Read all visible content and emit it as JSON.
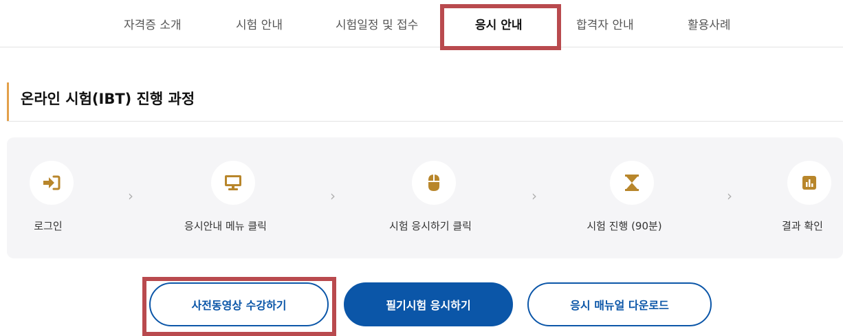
{
  "nav": {
    "items": [
      {
        "label": "자격증 소개"
      },
      {
        "label": "시험 안내"
      },
      {
        "label": "시험일정 및 접수"
      },
      {
        "label": "응시 안내"
      },
      {
        "label": "합격자 안내"
      },
      {
        "label": "활용사례"
      }
    ],
    "active_index": 3
  },
  "section": {
    "title": "온라인 시험(IBT) 진행 과정"
  },
  "steps": [
    {
      "label": "로그인",
      "icon": "login-icon"
    },
    {
      "label": "응시안내 메뉴 클릭",
      "icon": "monitor-icon"
    },
    {
      "label": "시험 응시하기 클릭",
      "icon": "mouse-icon"
    },
    {
      "label": "시험 진행 (90분)",
      "icon": "hourglass-icon"
    },
    {
      "label": "결과 확인",
      "icon": "chart-icon"
    }
  ],
  "buttons": {
    "video": "사전동영상 수강하기",
    "exam": "필기시험 응시하기",
    "manual": "응시 매뉴얼 다운로드"
  },
  "colors": {
    "primary": "#0b56a8",
    "accent": "#b8862b",
    "title_bar": "#e3a04a",
    "highlight": "#b94a4e"
  }
}
